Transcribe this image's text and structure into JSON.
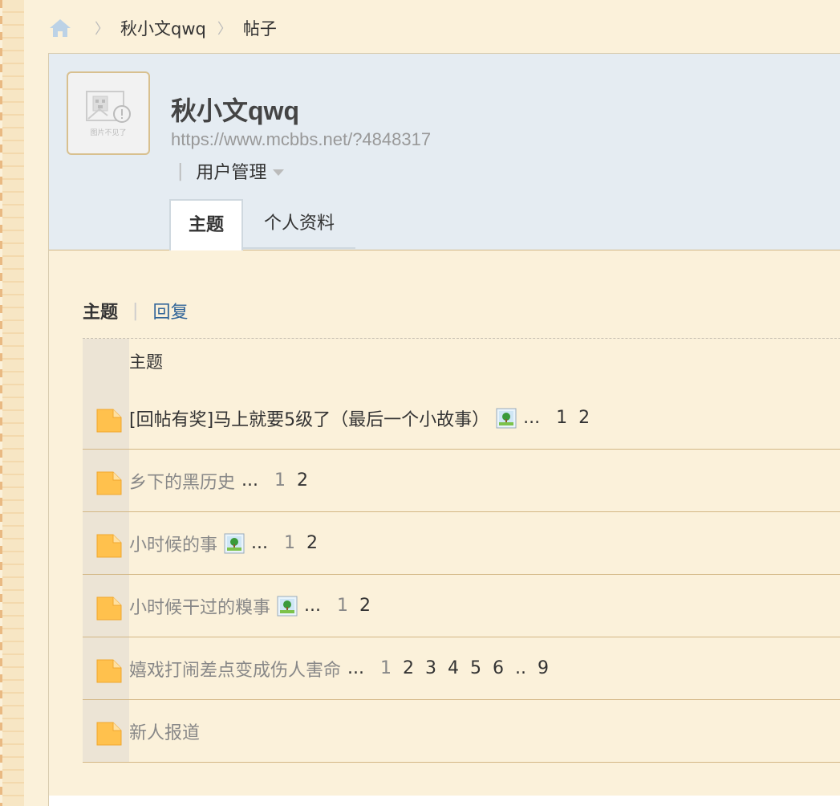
{
  "breadcrumb": {
    "home_icon": "home-icon",
    "items": [
      "秋小文qwq",
      "帖子"
    ],
    "separator": "〉"
  },
  "profile": {
    "avatar_icon": "image-broken-icon",
    "avatar_alt": "图片不见了",
    "username": "秋小文qwq",
    "link": "https://www.mcbbs.net/?4848317",
    "manage_label": "用户管理"
  },
  "tabs": [
    {
      "label": "主题",
      "active": true
    },
    {
      "label": "个人资料",
      "active": false
    }
  ],
  "subnav": {
    "current": "主题",
    "other": "回复"
  },
  "list": {
    "header": "主题",
    "rows": [
      {
        "title": "[回帖有奖]马上就要5级了（最后一个小故事）",
        "has_image": true,
        "pages": [
          "1",
          "2"
        ]
      },
      {
        "title": "乡下的黑历史",
        "has_image": false,
        "pages": [
          "1",
          "2"
        ]
      },
      {
        "title": "小时候的事",
        "has_image": true,
        "pages": [
          "1",
          "2"
        ]
      },
      {
        "title": "小时候干过的糗事",
        "has_image": true,
        "pages": [
          "1",
          "2"
        ]
      },
      {
        "title": "嬉戏打闹差点变成伤人害命",
        "has_image": false,
        "pages": [
          "1",
          "2",
          "3",
          "4",
          "5",
          "6",
          "..",
          "9"
        ]
      },
      {
        "title": "新人报道",
        "has_image": false,
        "pages": []
      }
    ]
  },
  "colors": {
    "background": "#fbf1da",
    "header_bg": "#e5ecf2",
    "link": "#336699",
    "folder": "#ffc14d"
  }
}
